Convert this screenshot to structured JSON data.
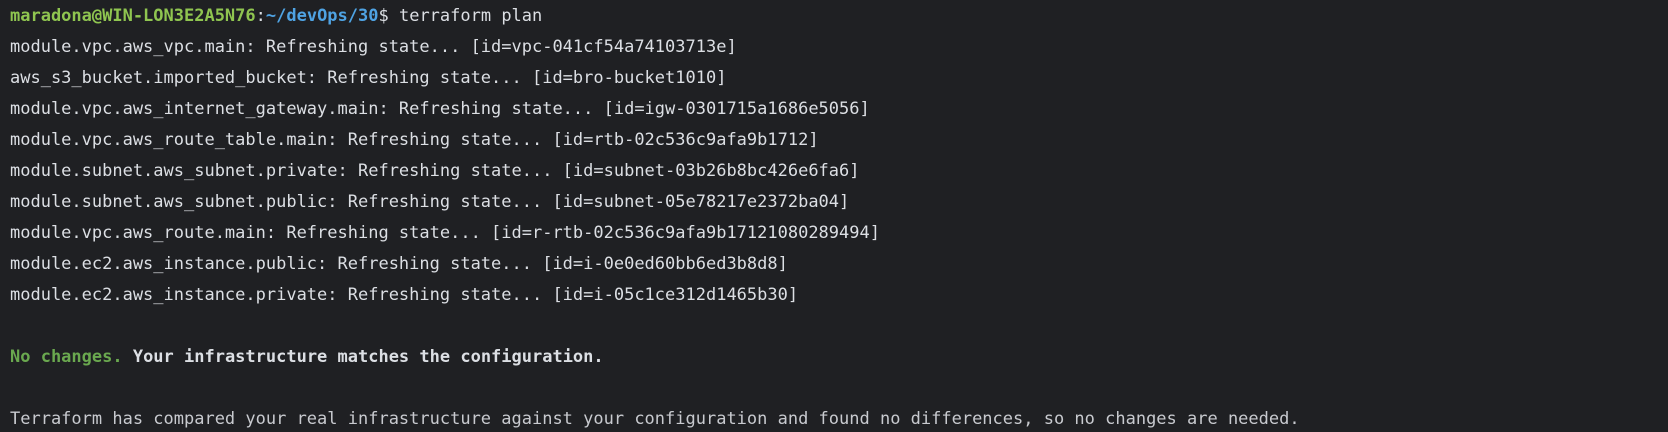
{
  "terminal": {
    "prompt": {
      "user_host": "maradona@WIN-LON3E2A5N76",
      "colon": ":",
      "path": "~/devOps/30",
      "dollar": "$",
      "command": " terraform plan"
    },
    "output_lines": [
      "module.vpc.aws_vpc.main: Refreshing state... [id=vpc-041cf54a74103713e]",
      "aws_s3_bucket.imported_bucket: Refreshing state... [id=bro-bucket1010]",
      "module.vpc.aws_internet_gateway.main: Refreshing state... [id=igw-0301715a1686e5056]",
      "module.vpc.aws_route_table.main: Refreshing state... [id=rtb-02c536c9afa9b1712]",
      "module.subnet.aws_subnet.private: Refreshing state... [id=subnet-03b26b8bc426e6fa6]",
      "module.subnet.aws_subnet.public: Refreshing state... [id=subnet-05e78217e2372ba04]",
      "module.vpc.aws_route.main: Refreshing state... [id=r-rtb-02c536c9afa9b17121080289494]",
      "module.ec2.aws_instance.public: Refreshing state... [id=i-0e0ed60bb6ed3b8d8]",
      "module.ec2.aws_instance.private: Refreshing state... [id=i-05c1ce312d1465b30]"
    ],
    "summary": {
      "status": "No changes.",
      "message": " Your infrastructure matches the configuration."
    },
    "detail": "Terraform has compared your real infrastructure against your configuration and found no differences, so no changes are needed."
  },
  "colors": {
    "background": "#1f2023",
    "text": "#dcdfe4",
    "prompt_user": "#8fc550",
    "prompt_path": "#4fa3e3",
    "status_green": "#6aa84f"
  }
}
